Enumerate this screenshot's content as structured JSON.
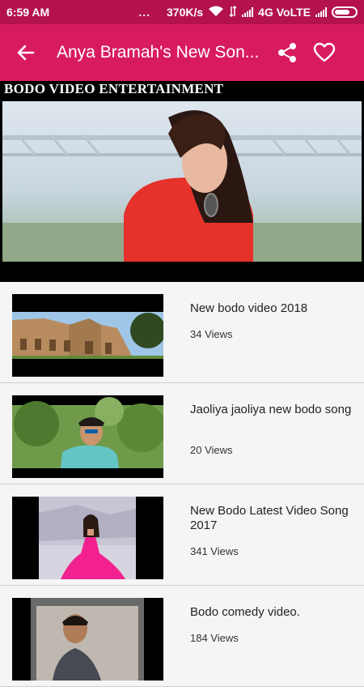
{
  "status_bar": {
    "time": "6:59 AM",
    "dots": "...",
    "speed": "370K/s",
    "network": "4G VoLTE"
  },
  "toolbar": {
    "title": "Anya Bramah's New Son...",
    "back_icon": "arrow-left-icon",
    "share_icon": "share-icon",
    "favorite_icon": "heart-outline-icon"
  },
  "player": {
    "banner": "BODO VIDEO ENTERTAINMENT"
  },
  "videos": [
    {
      "title": "New bodo video 2018",
      "views": "34 Views"
    },
    {
      "title": "Jaoliya jaoliya new bodo song",
      "views": "20 Views"
    },
    {
      "title": "New Bodo Latest Video Song 2017",
      "views": "341 Views"
    },
    {
      "title": "Bodo comedy video.",
      "views": "184 Views"
    }
  ],
  "colors": {
    "status_bar": "#b3124f",
    "toolbar": "#d81b60",
    "background": "#f5f5f5"
  }
}
